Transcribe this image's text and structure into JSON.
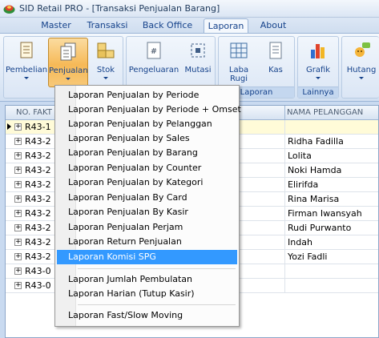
{
  "window": {
    "title": "SID Retail PRO - [Transaksi Penjualan Barang]"
  },
  "tabs": [
    "Master",
    "Transaksi",
    "Back Office",
    "Laporan",
    "About"
  ],
  "ribbon": {
    "buttons": {
      "pembelian": "Pembelian",
      "penjualan": "Penjualan",
      "stok": "Stok",
      "pengeluaran": "Pengeluaran",
      "mutasi": "Mutasi",
      "laba_rugi_1": "Laba",
      "laba_rugi_2": "Rugi",
      "kas": "Kas",
      "grafik": "Grafik",
      "hutang": "Hutang"
    },
    "groups": {
      "laporan": "Laporan",
      "lainnya": "Lainnya"
    }
  },
  "grid": {
    "col_faktur": "NO. FAKT",
    "col_nama": "NAMA PELANGGAN",
    "rows": [
      {
        "faktur": "R43-1",
        "nama": ""
      },
      {
        "faktur": "R43-2",
        "nama": "Ridha Fadilla"
      },
      {
        "faktur": "R43-2",
        "nama": "Lolita"
      },
      {
        "faktur": "R43-2",
        "nama": "Noki Hamda"
      },
      {
        "faktur": "R43-2",
        "nama": "Elirifda"
      },
      {
        "faktur": "R43-2",
        "nama": "Rina Marisa"
      },
      {
        "faktur": "R43-2",
        "nama": "Firman Iwansyah"
      },
      {
        "faktur": "R43-2",
        "nama": "Rudi Purwanto"
      },
      {
        "faktur": "R43-2",
        "nama": "Indah"
      },
      {
        "faktur": "R43-2",
        "nama": "Yozi Fadli"
      },
      {
        "faktur": "R43-0",
        "nama": ""
      },
      {
        "faktur": "R43-0",
        "nama": ""
      }
    ]
  },
  "menu": {
    "items": [
      "Laporan Penjualan by Periode",
      "Laporan Penjualan by Periode + Omset",
      "Laporan Penjualan by Pelanggan",
      "Laporan Penjualan by Sales",
      "Laporan Penjualan by Barang",
      "Laporan Penjualan by Counter",
      "Laporan Penjualan by Kategori",
      "Laporan Penjualan By Card",
      "Laporan Penjualan By Kasir",
      "Laporan Penjualan Perjam",
      "Laporan Return Penjualan",
      "Laporan Komisi SPG",
      "Laporan Jumlah Pembulatan",
      "Laporan Harian (Tutup Kasir)",
      "Laporan Fast/Slow Moving"
    ]
  },
  "colors": {
    "highlight": "#3399ff",
    "pressed": "#f6b957",
    "ribbon_text": "#15428b"
  }
}
